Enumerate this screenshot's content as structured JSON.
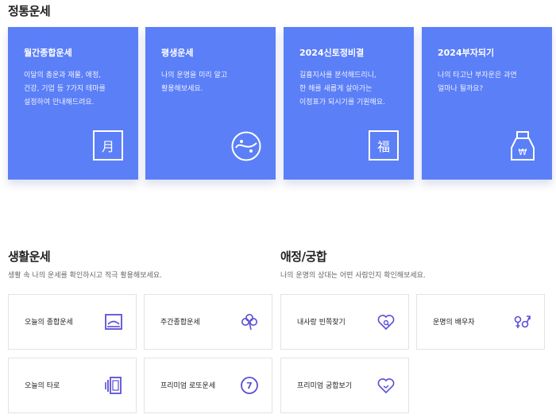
{
  "fortune": {
    "title": "정통운세",
    "cards": [
      {
        "title": "월간종합운세",
        "lines": [
          "이달의 총운과 재물, 애정,",
          "건강, 기업 등 7가지 테마를",
          "설정하여 안내해드려요."
        ],
        "icon": "calendar-month-icon",
        "glyph": "月"
      },
      {
        "title": "평생운세",
        "lines": [
          "나의 운명을 미리 알고",
          "활용해보세요."
        ],
        "icon": "yin-yang-icon"
      },
      {
        "title": "2024신토정비결",
        "lines": [
          "길흉지사를 분석해드리니,",
          "한 해를 새롭게 살아가는",
          "이정표가 되시기를 기원해요."
        ],
        "icon": "blessing-icon",
        "glyph": "福"
      },
      {
        "title": "2024부자되기",
        "lines": [
          "나의 타고난 부자운은 과연",
          "얼마나 될까요?"
        ],
        "icon": "money-bag-icon"
      }
    ]
  },
  "life": {
    "title": "생활운세",
    "desc": "생활 속 나의 운세를 확인하시고 적극 활용해보세요.",
    "tiles": [
      {
        "label": "오늘의 종합운세",
        "icon": "sunrise-icon"
      },
      {
        "label": "주간종합운세",
        "icon": "clover-icon"
      },
      {
        "label": "오늘의 타로",
        "icon": "tarot-cards-icon"
      },
      {
        "label": "프리미엄 로또운세",
        "icon": "lotto-ball-icon"
      }
    ]
  },
  "love": {
    "title": "애정/궁합",
    "desc": "나의 운명의 상대는 어떤 사람인지 확인해보세요.",
    "tiles": [
      {
        "label": "내사랑 빈쪽찾기",
        "icon": "heart-search-icon"
      },
      {
        "label": "운명의 배우자",
        "icon": "gender-icon"
      },
      {
        "label": "프리미엄 궁합보기",
        "icon": "heart-link-icon"
      }
    ]
  },
  "colors": {
    "card_bg": "#5b7ff7",
    "icon_purple": "#5b4fd6"
  }
}
